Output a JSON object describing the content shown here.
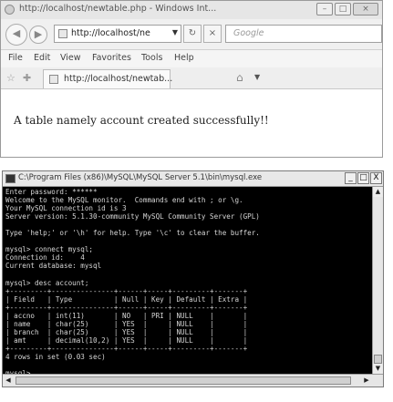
{
  "browser": {
    "title": "http://localhost/newtable.php - Windows Int...",
    "caption": {
      "minimize": "–",
      "maximize": "□",
      "close": "×"
    },
    "address": "http://localhost/ne",
    "search_placeholder": "Google",
    "menu": [
      "File",
      "Edit",
      "View",
      "Favorites",
      "Tools",
      "Help"
    ],
    "tab_label": "http://localhost/newtab...",
    "message": "A table namely account created successfully!!"
  },
  "console": {
    "title": "C:\\Program Files (x86)\\MySQL\\MySQL Server 5.1\\bin\\mysql.exe",
    "caption": {
      "minimize": "_",
      "maximize": "□",
      "close": "X"
    },
    "lines": [
      "Enter password: ******",
      "Welcome to the MySQL monitor.  Commands end with ; or \\g.",
      "Your MySQL connection id is 3",
      "Server version: 5.1.30-community MySQL Community Server (GPL)",
      "",
      "Type 'help;' or '\\h' for help. Type '\\c' to clear the buffer.",
      "",
      "mysql> connect mysql;",
      "Connection id:    4",
      "Current database: mysql",
      "",
      "mysql> desc account;",
      "+---------+---------------+------+-----+---------+-------+",
      "| Field   | Type          | Null | Key | Default | Extra |",
      "+---------+---------------+------+-----+---------+-------+",
      "| accno   | int(11)       | NO   | PRI | NULL    |       |",
      "| name    | char(25)      | YES  |     | NULL    |       |",
      "| branch  | char(25)      | YES  |     | NULL    |       |",
      "| amt     | decimal(10,2) | YES  |     | NULL    |       |",
      "+---------+---------------+------+-----+---------+-------+",
      "4 rows in set (0.03 sec)",
      "",
      "mysql> _"
    ]
  }
}
